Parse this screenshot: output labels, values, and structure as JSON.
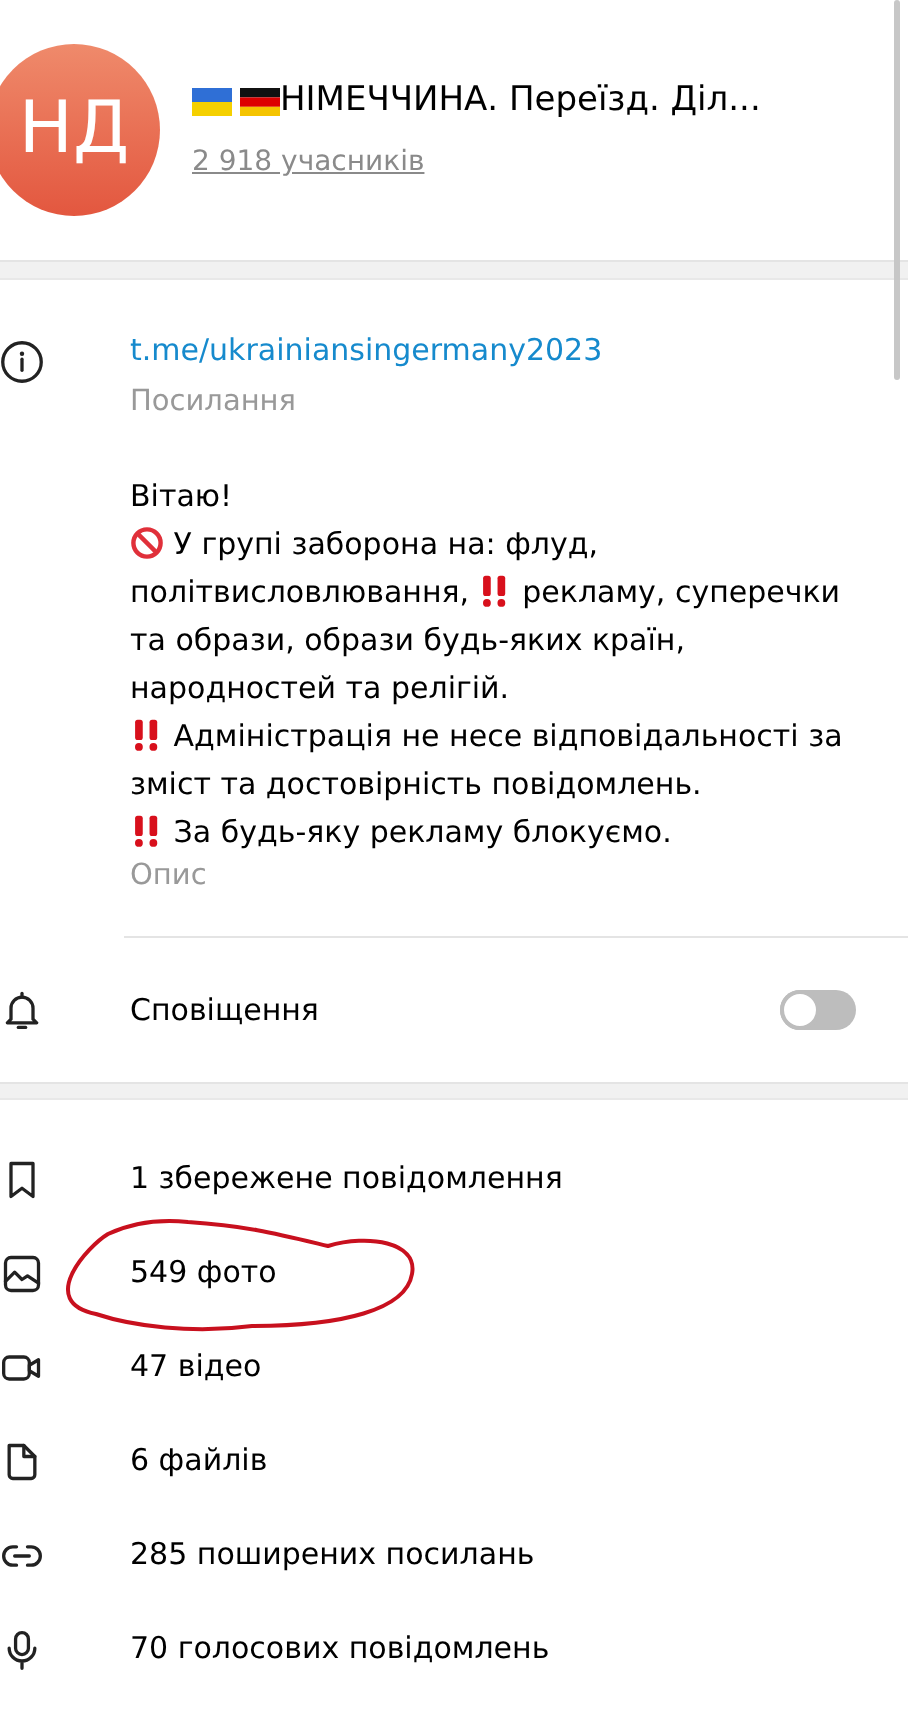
{
  "group": {
    "avatar_initials": "НД",
    "title": "НІМЕЧЧИНА. Переїзд. Діл...",
    "members": "2 918 учасників"
  },
  "info": {
    "link": "t.me/ukrainiansingermany2023",
    "link_caption": "Посилання",
    "description_lines": [
      [
        {
          "kind": "text",
          "text": "Вітаю!"
        }
      ],
      [
        {
          "kind": "prohibited-emoji"
        },
        {
          "kind": "text",
          "text": "У групі заборона на: флуд,"
        }
      ],
      [
        {
          "kind": "text",
          "text": "політвисловлювання,"
        },
        {
          "kind": "exclamation-emoji"
        },
        {
          "kind": "text",
          "text": "рекламу, суперечки"
        }
      ],
      [
        {
          "kind": "text",
          "text": "та образи, образи будь-яких країн,"
        }
      ],
      [
        {
          "kind": "text",
          "text": "народностей та релігій."
        }
      ],
      [
        {
          "kind": "exclamation-emoji"
        },
        {
          "kind": "text",
          "text": "Адміністрація не несе відповідальності за"
        }
      ],
      [
        {
          "kind": "text",
          "text": "зміст та достовірність повідомлень."
        }
      ],
      [
        {
          "kind": "exclamation-emoji"
        },
        {
          "kind": "text",
          "text": "За будь-яку рекламу блокуємо."
        }
      ]
    ],
    "description_caption": "Опис"
  },
  "notifications": {
    "label": "Сповіщення",
    "on": false
  },
  "media": [
    {
      "kind": "saved",
      "label": "1 збережене повідомлення",
      "circled": false
    },
    {
      "kind": "photo",
      "label": "549 фото",
      "circled": true
    },
    {
      "kind": "video",
      "label": "47 відео",
      "circled": false
    },
    {
      "kind": "file",
      "label": "6 файлів",
      "circled": false
    },
    {
      "kind": "link",
      "label": "285 поширених посилань",
      "circled": false
    },
    {
      "kind": "voice",
      "label": "70 голосових повідомлень",
      "circled": false
    }
  ]
}
